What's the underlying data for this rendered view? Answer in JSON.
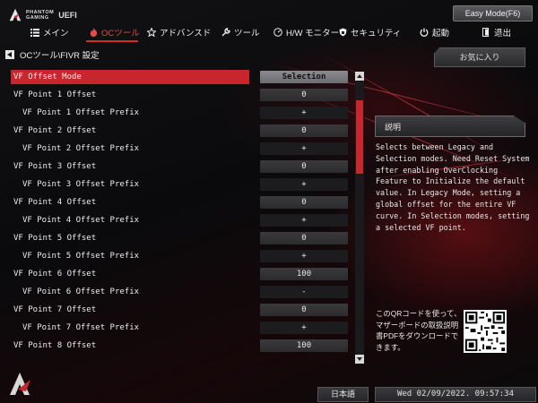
{
  "header": {
    "brand_line1": "PHANTOM",
    "brand_line2": "GAMING",
    "brand_uefi": "UEFI",
    "mode_button": "Easy Mode(F6)"
  },
  "nav": [
    {
      "label": "メイン",
      "icon": "list-icon"
    },
    {
      "label": "OCツール",
      "icon": "flame-icon",
      "active": true
    },
    {
      "label": "アドバンスド",
      "icon": "star-icon"
    },
    {
      "label": "ツール",
      "icon": "wrench-icon"
    },
    {
      "label": "H/W モニター",
      "icon": "monitor-icon"
    },
    {
      "label": "セキュリティ",
      "icon": "shield-icon"
    },
    {
      "label": "起動",
      "icon": "power-icon"
    },
    {
      "label": "退出",
      "icon": "exit-icon"
    }
  ],
  "breadcrumb": "OCツール\\FIVR 設定",
  "favorites_button": "お気に入り",
  "settings": [
    {
      "label": "VF Offset Mode",
      "value": "Selection",
      "indent": false,
      "selected": true
    },
    {
      "label": "VF Point 1 Offset",
      "value": "0",
      "indent": false
    },
    {
      "label": "VF Point 1 Offset Prefix",
      "value": "+",
      "indent": true
    },
    {
      "label": "VF Point 2 Offset",
      "value": "0",
      "indent": false
    },
    {
      "label": "VF Point 2 Offset Prefix",
      "value": "+",
      "indent": true
    },
    {
      "label": "VF Point 3 Offset",
      "value": "0",
      "indent": false
    },
    {
      "label": "VF Point 3 Offset Prefix",
      "value": "+",
      "indent": true
    },
    {
      "label": "VF Point 4 Offset",
      "value": "0",
      "indent": false
    },
    {
      "label": "VF Point 4 Offset Prefix",
      "value": "+",
      "indent": true
    },
    {
      "label": "VF Point 5 Offset",
      "value": "0",
      "indent": false
    },
    {
      "label": "VF Point 5 Offset Prefix",
      "value": "+",
      "indent": true
    },
    {
      "label": "VF Point 6 Offset",
      "value": "100",
      "indent": false
    },
    {
      "label": "VF Point 6 Offset Prefix",
      "value": "-",
      "indent": true
    },
    {
      "label": "VF Point 7 Offset",
      "value": "0",
      "indent": false
    },
    {
      "label": "VF Point 7 Offset Prefix",
      "value": "+",
      "indent": true
    },
    {
      "label": "VF Point 8 Offset",
      "value": "100",
      "indent": false
    }
  ],
  "description": {
    "title": "説明",
    "text": "Selects between Legacy and Selection modes. Need Reset System after enabling OverClocking Feature to Initialize the default value. In Legacy Mode, setting a global offset for the entire VF curve. In Selection modes, setting a selected VF point."
  },
  "qr_text": "このQRコードを使って、マザーボードの取扱説明書PDFをダウンロードできます。",
  "footer": {
    "language": "日本語",
    "datetime": "Wed 02/09/2022. 09:57:34"
  },
  "colors": {
    "accent_red": "#c8262c",
    "active_nav": "#e84a4a"
  }
}
